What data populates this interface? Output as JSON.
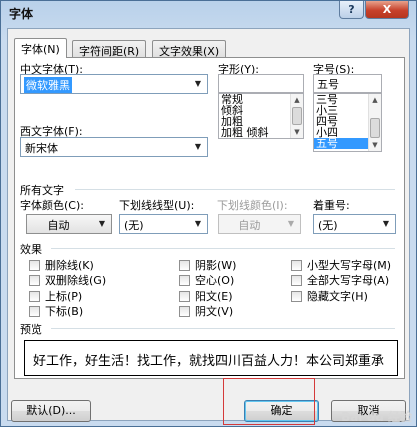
{
  "window": {
    "title": "字体",
    "help_label": "?",
    "close_label": "X"
  },
  "tabs": [
    {
      "label": "字体(N)",
      "active": true
    },
    {
      "label": "字符间距(R)",
      "active": false
    },
    {
      "label": "文字效果(X)",
      "active": false
    }
  ],
  "font": {
    "chinese_label": "中文字体(T):",
    "chinese_value": "微软雅黑",
    "western_label": "西文字体(F):",
    "western_value": "新宋体",
    "style_label": "字形(Y):",
    "style_value": "",
    "style_options": [
      "常规",
      "倾斜",
      "加粗",
      "加粗 倾斜"
    ],
    "size_label": "字号(S):",
    "size_value": "五号",
    "size_options": [
      "三号",
      "小三",
      "四号",
      "小四",
      "五号"
    ],
    "size_selected_index": 4
  },
  "all_text": {
    "section_label": "所有文字",
    "color_label": "字体颜色(C):",
    "color_value": "自动",
    "underline_label": "下划线线型(U):",
    "underline_value": "(无)",
    "underline_color_label": "下划线颜色(I):",
    "underline_color_value": "自动",
    "emphasis_label": "着重号:",
    "emphasis_value": "(无)"
  },
  "effects": {
    "section_label": "效果",
    "col1": [
      "删除线(K)",
      "双删除线(G)",
      "上标(P)",
      "下标(B)"
    ],
    "col2": [
      "阴影(W)",
      "空心(O)",
      "阳文(E)",
      "阴文(V)"
    ],
    "col3": [
      "小型大写字母(M)",
      "全部大写字母(A)",
      "隐藏文字(H)"
    ]
  },
  "preview": {
    "section_label": "预览",
    "text": "好工作，好生活！找工作，就找四川百益人力！本公司郑重承"
  },
  "buttons": {
    "default_label": "默认(D)...",
    "ok_label": "确定",
    "cancel_label": "取消"
  },
  "watermark": "Bai du 经验"
}
